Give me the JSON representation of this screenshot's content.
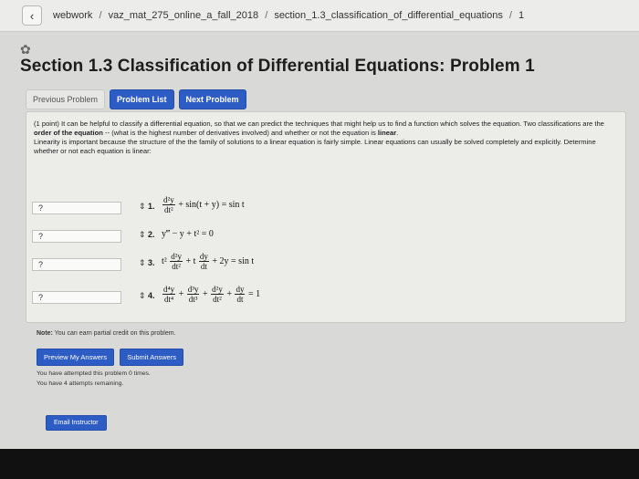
{
  "breadcrumb": {
    "parts": [
      "webwork",
      "vaz_mat_275_online_a_fall_2018",
      "section_1.3_classification_of_differential_equations",
      "1"
    ]
  },
  "page_title": "Section 1.3 Classification of Differential Equations: Problem 1",
  "nav": {
    "previous": "Previous Problem",
    "list": "Problem List",
    "next": "Next Problem"
  },
  "intro": {
    "p1_start": "(1 point) It can be helpful to classify a differential equation, so that we can predict the techniques that might help us to find a function which solves the equation. Two classifications are the ",
    "p1_bold1": "order of the equation",
    "p1_mid": " -- (what is the highest number of derivatives involved) and whether or not the equation is ",
    "p1_bold2": "linear",
    "p1_end": ".",
    "p2": "Linearity is important because the structure of the the family of solutions to a linear equation is fairly simple. Linear equations can usually be solved completely and explicitly. Determine whether or not each equation is linear:"
  },
  "questions": [
    {
      "number": "1.",
      "answer": "?"
    },
    {
      "number": "2.",
      "answer": "?"
    },
    {
      "number": "3.",
      "answer": "?"
    },
    {
      "number": "4.",
      "answer": "?"
    }
  ],
  "equations": {
    "q1": {
      "num": "d²y",
      "den": "dt²",
      "rest": "+ sin(t + y) = sin t"
    },
    "q2": {
      "text": "y‴ − y + t² = 0"
    },
    "q3": {
      "coef": "t²",
      "num1": "d²y",
      "den1": "dt²",
      "mid": "+ t",
      "num2": "dy",
      "den2": "dt",
      "rest": "+ 2y = sin t"
    },
    "q4": {
      "num1": "d⁴y",
      "den1": "dt⁴",
      "num2": "d³y",
      "den2": "dt³",
      "num3": "d²y",
      "den3": "dt²",
      "num4": "dy",
      "den4": "dt",
      "rest": "= 1"
    }
  },
  "note": {
    "label": "Note:",
    "text": " You can earn partial credit on this problem."
  },
  "buttons": {
    "preview": "Preview My Answers",
    "submit": "Submit Answers",
    "email": "Email Instructor"
  },
  "attempts": {
    "line1": "You have attempted this problem 0 times.",
    "line2": "You have 4 attempts remaining."
  },
  "icons": {
    "back": "chevron-left-icon",
    "updown": "updown-arrows-icon",
    "logo": "webwork-logo-icon"
  },
  "colors": {
    "accent": "#2d5cc4"
  }
}
